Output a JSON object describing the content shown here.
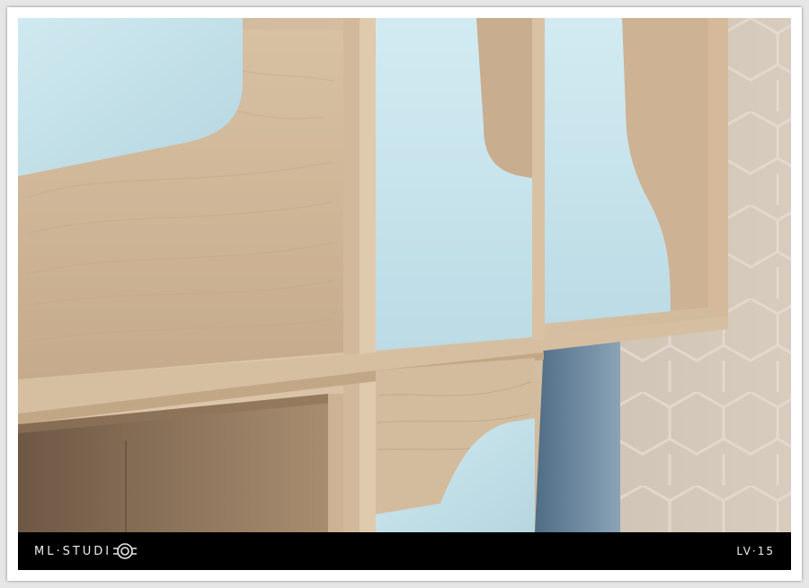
{
  "footer": {
    "brand": "ML·STUDI",
    "code": "LV·15"
  },
  "icons": {
    "brand_logo": "camera-lens-logo-icon"
  },
  "colors": {
    "wood": "#d8c2a6",
    "panel_blue": "#c7e4ec",
    "footer_bg": "#000000",
    "wall": "#cfc3b4"
  }
}
